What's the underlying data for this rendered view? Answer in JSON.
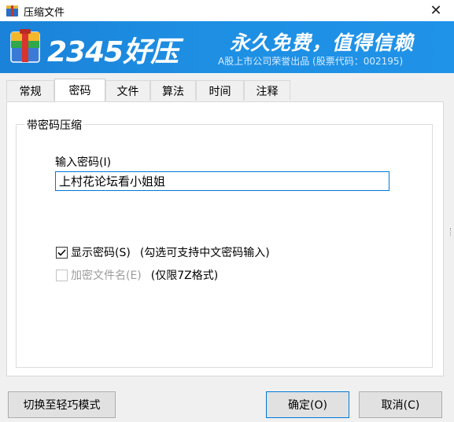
{
  "window": {
    "title": "压缩文件",
    "close_glyph": "✕"
  },
  "banner": {
    "brand": "2345好压",
    "slogan": "永久免费，值得信赖",
    "company": "A股上市公司荣誉出品 (股票代码：002195)"
  },
  "tabs": [
    {
      "label": "常规",
      "active": false
    },
    {
      "label": "密码",
      "active": true
    },
    {
      "label": "文件",
      "active": false
    },
    {
      "label": "算法",
      "active": false
    },
    {
      "label": "时间",
      "active": false
    },
    {
      "label": "注释",
      "active": false
    }
  ],
  "password_group": {
    "title": "带密码压缩",
    "input_label": "输入密码(I)",
    "input_value": "上村花论坛看小姐姐",
    "show_password": {
      "label": "显示密码(S)",
      "checked": true,
      "hint": "(勾选可支持中文密码输入)"
    },
    "encrypt_filename": {
      "label": "加密文件名(E)",
      "checked": false,
      "disabled": true,
      "hint": "(仅限7Z格式)"
    }
  },
  "buttons": {
    "light_mode": "切换至轻巧模式",
    "ok": "确定(O)",
    "cancel": "取消(C)"
  },
  "colors": {
    "banner_blue": "#1e8fe3",
    "focus_blue": "#0078d7"
  }
}
